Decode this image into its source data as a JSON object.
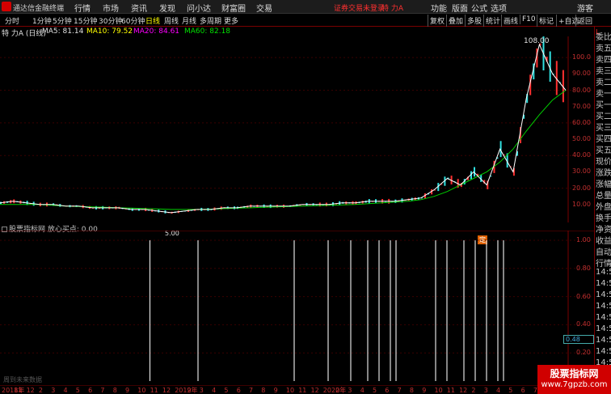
{
  "menubar": {
    "app_title": "通达信金融终端",
    "items": [
      "行情",
      "市场",
      "资讯",
      "发现",
      "问小达",
      "财富圈",
      "交易"
    ],
    "notice": "证券交易未登录",
    "stock_name": "特 力A",
    "right_items": [
      "功能",
      "版面",
      "公式",
      "选项",
      "游客"
    ]
  },
  "periodbar": {
    "items": [
      "分时",
      "1分钟",
      "5分钟",
      "15分钟",
      "30分钟",
      "60分钟",
      "日线",
      "周线",
      "月线",
      "多周期",
      "更多"
    ],
    "active": "日线",
    "right_buttons": [
      "复权",
      "叠加",
      "多股",
      "统计",
      "画线",
      "F10",
      "标记",
      "+自选",
      "返回"
    ]
  },
  "ma": {
    "title": "特 力A (日线)",
    "ma5": "MA5: 81.14",
    "ma10": "MA10: 79.52",
    "ma20": "MA20: 84.61",
    "ma60": "MA60: 82.18",
    "colors": {
      "title": "#e0e0e0",
      "ma5": "#e0e0e0",
      "ma10": "#ffff00",
      "ma20": "#ff00ff",
      "ma60": "#00e000"
    }
  },
  "annotations": {
    "peak_price": "108.00",
    "low_price": "5.00",
    "ding": "定",
    "nodata": "周到未来数据"
  },
  "price_axis": [
    "100.0",
    "90.00",
    "80.00",
    "70.00",
    "60.00",
    "50.00",
    "40.00",
    "30.00",
    "20.00",
    "10.00"
  ],
  "indicator": {
    "title": "股票指标网 放心买点: 0.00",
    "axis": [
      "1.00",
      "0.80",
      "0.60",
      "0.40",
      "0.20"
    ],
    "current_value": "0.48"
  },
  "sidepanel": {
    "head": "L",
    "items": [
      "委比",
      "卖五",
      "卖四",
      "卖三",
      "卖二",
      "卖一",
      "买一",
      "买二",
      "买三",
      "买四",
      "买五",
      "现价",
      "涨跌",
      "涨幅",
      "总量",
      "外盘",
      "换手",
      "净资",
      "收益",
      "自动",
      "行情",
      "14:5",
      "14:5",
      "14:5",
      "14:5",
      "14:5",
      "14:5",
      "14:5",
      "14:5",
      "14:5",
      "14:5"
    ]
  },
  "datebar": {
    "labels": [
      "2018年",
      "11",
      "12",
      "2",
      "3",
      "4",
      "5",
      "6",
      "7",
      "8",
      "9",
      "10",
      "11",
      "12",
      "2019年",
      "2",
      "3",
      "4",
      "5",
      "6",
      "7",
      "8",
      "9",
      "10",
      "11",
      "12",
      "2020年",
      "2",
      "3",
      "4",
      "5",
      "6",
      "7",
      "8",
      "9",
      "10",
      "11",
      "12",
      "2",
      "3",
      "4",
      "5",
      "6",
      "7",
      "8",
      "9"
    ]
  },
  "chart_data": {
    "type": "line",
    "ylim": [
      0,
      108
    ],
    "series": [
      {
        "name": "MA60",
        "values": [
          10,
          10,
          10,
          10,
          9.5,
          9,
          8.8,
          8.5,
          8.3,
          8,
          7.8,
          7.5,
          7.3,
          7,
          7,
          7,
          7.2,
          7.5,
          7.8,
          8,
          8.3,
          8.5,
          8.8,
          9,
          9.3,
          9.5,
          9.8,
          10,
          10.5,
          11,
          11.5,
          12,
          13,
          15,
          18,
          22,
          26,
          30,
          36,
          44,
          55,
          65,
          74,
          80
        ]
      },
      {
        "name": "price",
        "values": [
          11,
          12,
          11,
          10,
          10,
          9,
          9,
          8,
          8,
          8,
          7,
          7,
          6,
          5,
          6,
          7,
          7,
          8,
          8,
          9,
          9,
          9,
          9,
          10,
          10,
          10,
          11,
          11,
          12,
          12,
          12,
          13,
          14,
          19,
          26,
          22,
          30,
          22,
          44,
          30,
          75,
          108,
          90,
          80
        ]
      }
    ],
    "signals": [
      0.265,
      0.35,
      0.52,
      0.58,
      0.62,
      0.65,
      0.67,
      0.69,
      0.7,
      0.77,
      0.79,
      0.82,
      0.84,
      0.86,
      0.88,
      0.89
    ]
  }
}
